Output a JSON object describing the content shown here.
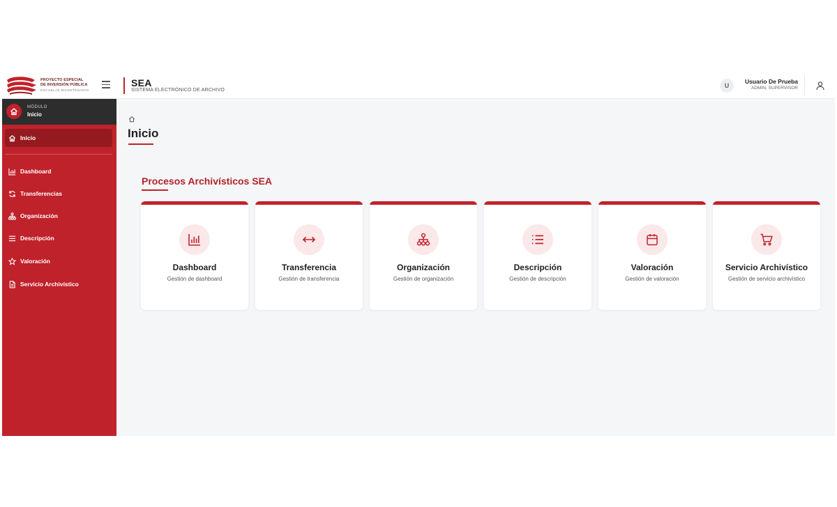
{
  "header": {
    "logo_lines": [
      "PROYECTO ESPECIAL",
      "DE INVERSIÓN PÚBLICA",
      "ESCUELAS BICENTENARIO"
    ],
    "brand_title": "SEA",
    "brand_subtitle": "SISTEMA ELECTRÓNICO DE ARCHIVO",
    "user_initial": "U",
    "user_name": "Usuario De Prueba",
    "user_role": "ADMIN, SUPERVISOR"
  },
  "sidebar": {
    "module_label": "MÓDULO",
    "module_value": "Inicio",
    "items": [
      {
        "label": "Inicio",
        "icon": "home-icon"
      },
      {
        "label": "Dashboard",
        "icon": "bar-chart-icon"
      },
      {
        "label": "Transferencias",
        "icon": "refresh-icon"
      },
      {
        "label": "Organización",
        "icon": "sitemap-icon"
      },
      {
        "label": "Descripción",
        "icon": "list-icon"
      },
      {
        "label": "Valoración",
        "icon": "star-icon"
      },
      {
        "label": "Servicio Archivístico",
        "icon": "document-icon"
      }
    ]
  },
  "main": {
    "page_title": "Inicio",
    "section_title": "Procesos Archivísticos SEA",
    "cards": [
      {
        "title": "Dashboard",
        "desc": "Gestión de dashboard",
        "icon": "bar-chart-icon"
      },
      {
        "title": "Transferencia",
        "desc": "Gestión de transferencia",
        "icon": "arrows-horizontal-icon"
      },
      {
        "title": "Organización",
        "desc": "Gestión de organización",
        "icon": "sitemap-icon"
      },
      {
        "title": "Descripción",
        "desc": "Gestión de descripción",
        "icon": "list-icon"
      },
      {
        "title": "Valoración",
        "desc": "Gestión de valoración",
        "icon": "calendar-icon"
      },
      {
        "title": "Servicio Archivístico",
        "desc": "Gestión de servicio archivístico",
        "icon": "cart-icon"
      }
    ]
  },
  "colors": {
    "primary": "#c0222b",
    "sidebar_active": "#951a20",
    "module_bg": "#2d2d2d",
    "icon_circle": "#fbe8e9",
    "content_bg": "#f5f6f8"
  }
}
